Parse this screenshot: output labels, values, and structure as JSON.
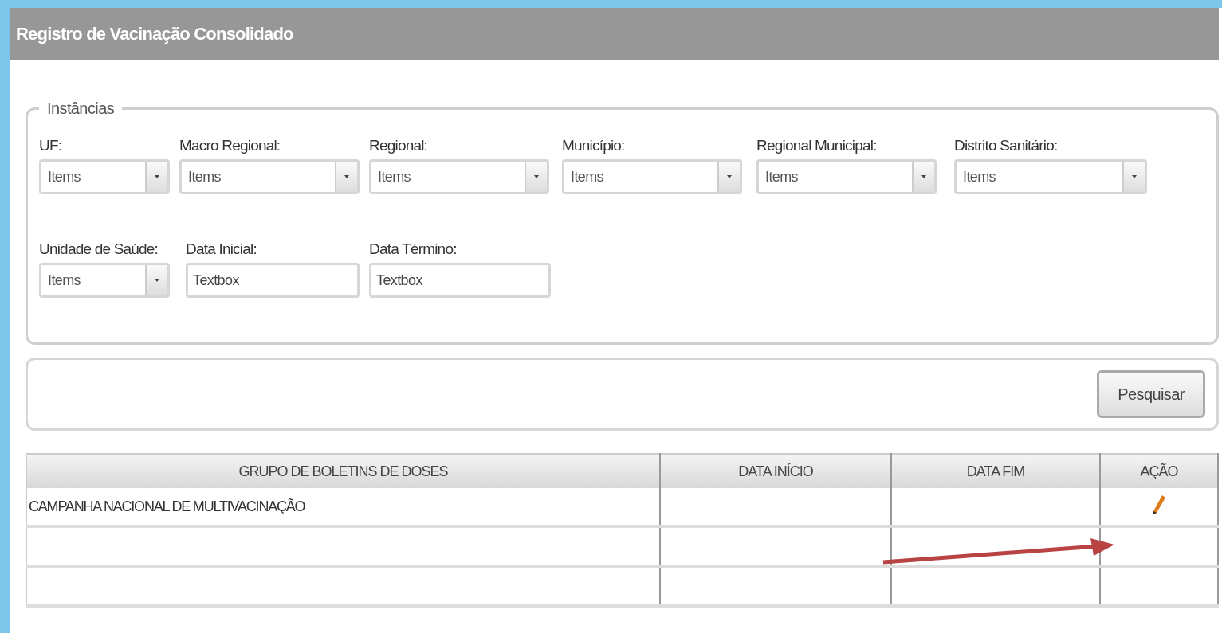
{
  "window": {
    "title": "Registro de Vacinação Consolidado"
  },
  "filters": {
    "legend": "Instâncias",
    "rows": [
      [
        {
          "label": "UF:",
          "kind": "select",
          "value": "Items"
        },
        {
          "label": "Macro Regional:",
          "kind": "select",
          "value": "Items"
        },
        {
          "label": "Regional:",
          "kind": "select",
          "value": "Items"
        },
        {
          "label": "Município:",
          "kind": "select",
          "value": "Items"
        },
        {
          "label": "Regional Municipal:",
          "kind": "select",
          "value": "Items"
        },
        {
          "label": "Distrito Sanitário:",
          "kind": "select",
          "value": "Items"
        }
      ],
      [
        {
          "label": "Unidade de Saúde:",
          "kind": "select",
          "value": "Items"
        },
        {
          "label": "Data Inicial:",
          "kind": "text",
          "value": "Textbox"
        },
        {
          "label": "Data Término:",
          "kind": "text",
          "value": "Textbox"
        }
      ]
    ]
  },
  "search_button": "Pesquisar",
  "table": {
    "columns": [
      "GRUPO DE BOLETINS DE DOSES",
      "DATA INÍCIO",
      "DATA FIM",
      "AÇÃO"
    ],
    "rows": [
      {
        "group": "CAMPANHA NACIONAL DE MULTIVACINAÇÃO",
        "has_edit": true
      },
      {
        "has_edit": false
      },
      {
        "has_edit": false
      }
    ]
  },
  "annotation": {
    "kind": "arrow"
  }
}
